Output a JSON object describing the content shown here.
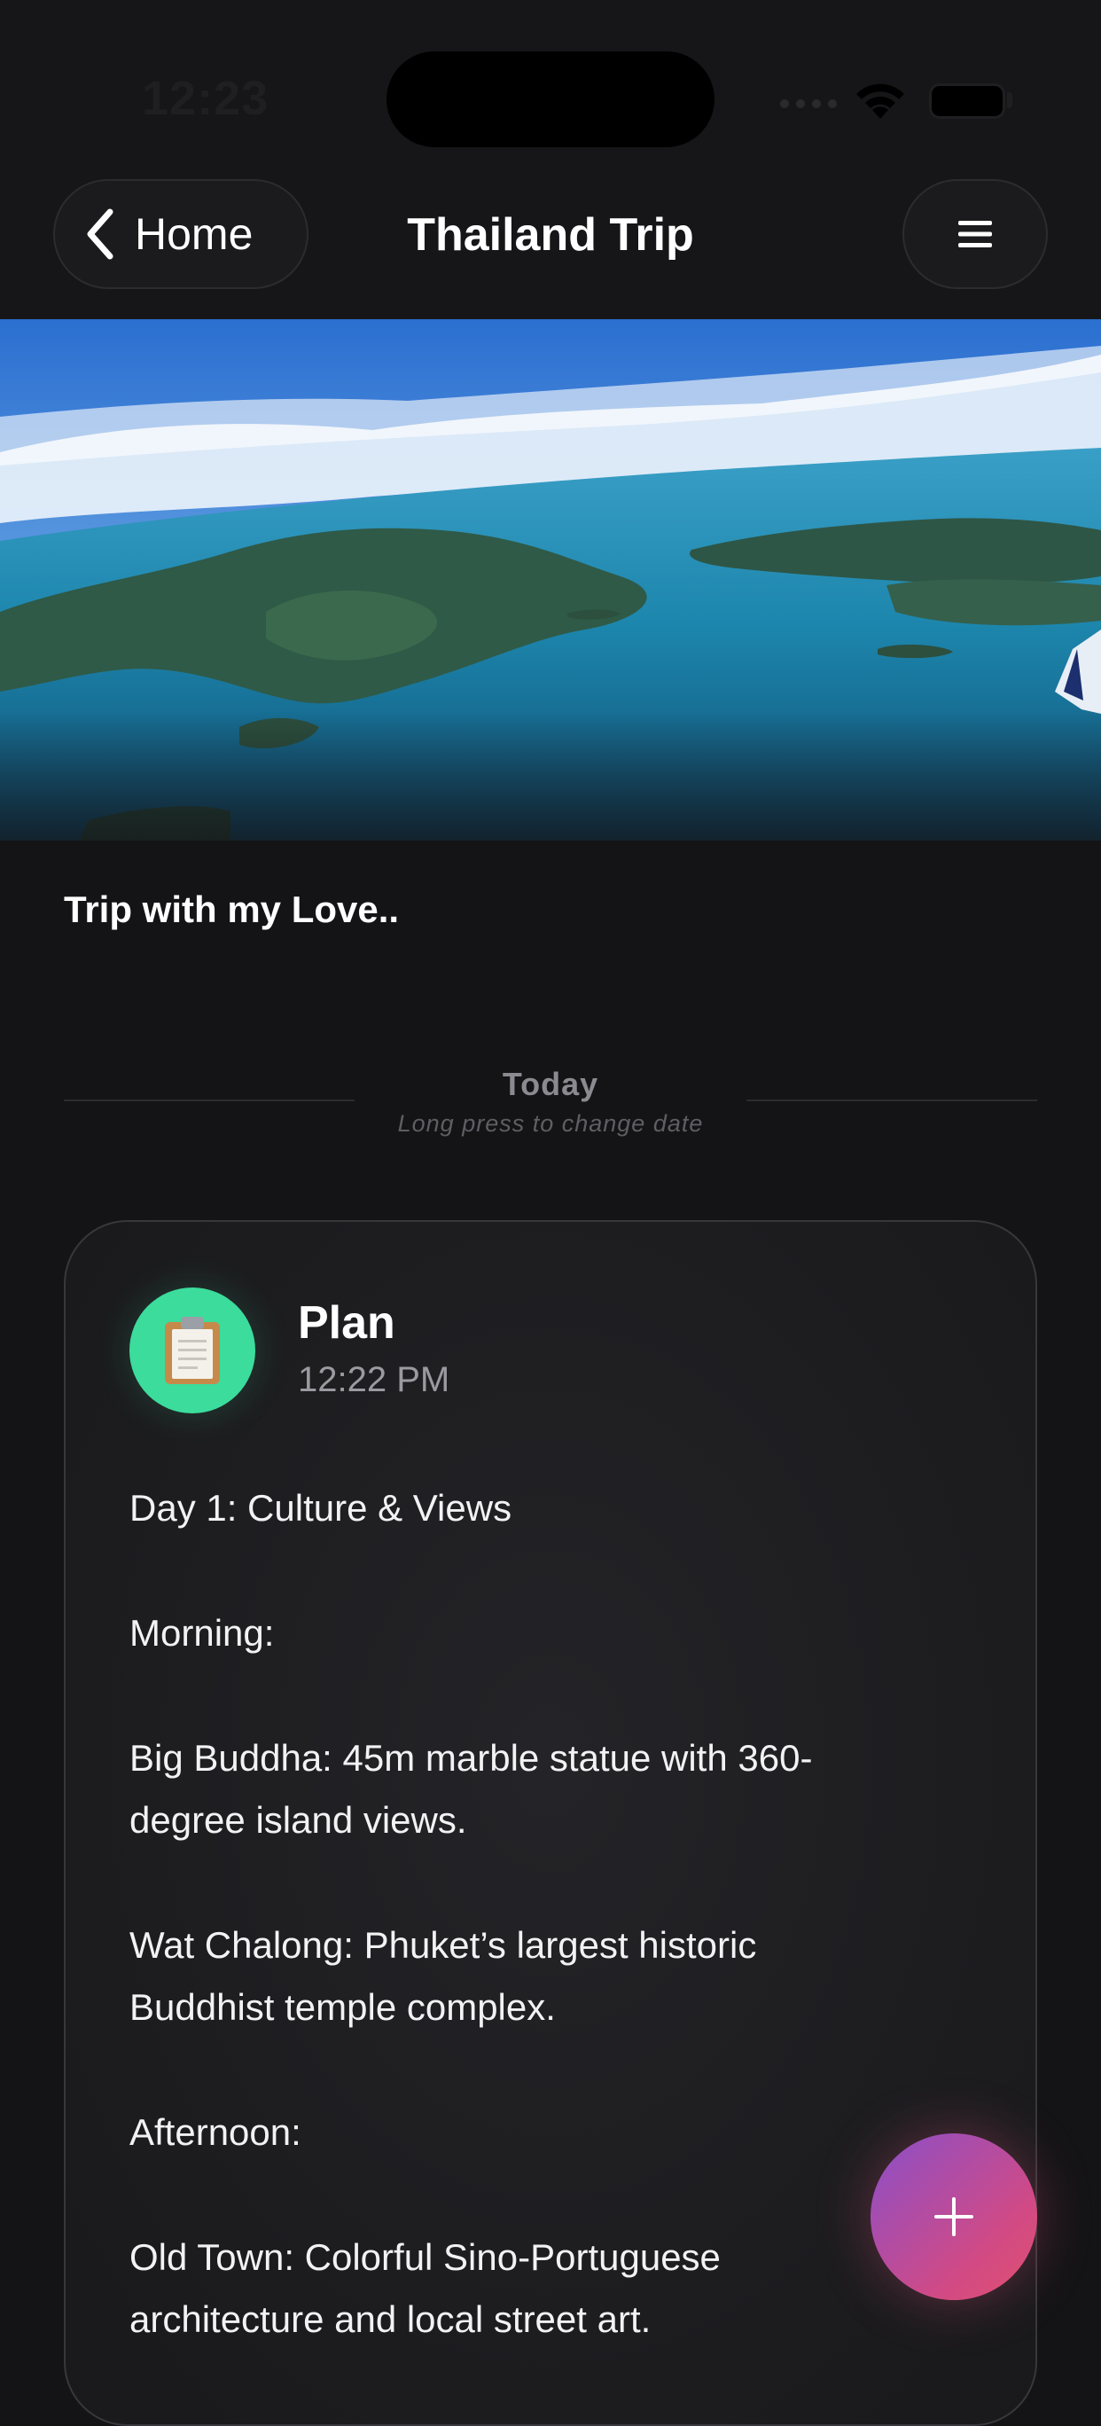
{
  "status_bar": {
    "time": "12:23"
  },
  "nav": {
    "back_label": "Home",
    "title": "Thailand Trip",
    "back_icon": "chevron-left-icon",
    "menu_icon": "hamburger-menu-icon"
  },
  "trip": {
    "description": "Trip with my Love.."
  },
  "date_divider": {
    "label": "Today",
    "hint": "Long press to change date"
  },
  "entry": {
    "icon": "clipboard-icon",
    "title": "Plan",
    "time": "12:22 PM",
    "lines": [
      "Day 1: Culture & Views",
      "",
      "Morning:",
      "",
      "Big Buddha: 45m marble statue with 360-",
      "degree island views.",
      "",
      "Wat Chalong: Phuket’s largest historic",
      "Buddhist temple complex.",
      "",
      "Afternoon:",
      "",
      "Old Town: Colorful Sino-Portuguese",
      "architecture and local street art."
    ]
  },
  "fab": {
    "icon": "plus-icon"
  },
  "colors": {
    "background": "#141416",
    "plan_accent": "#3cdc9c",
    "fab_gradient_start": "#8a4fc9",
    "fab_gradient_end": "#e0506e"
  }
}
